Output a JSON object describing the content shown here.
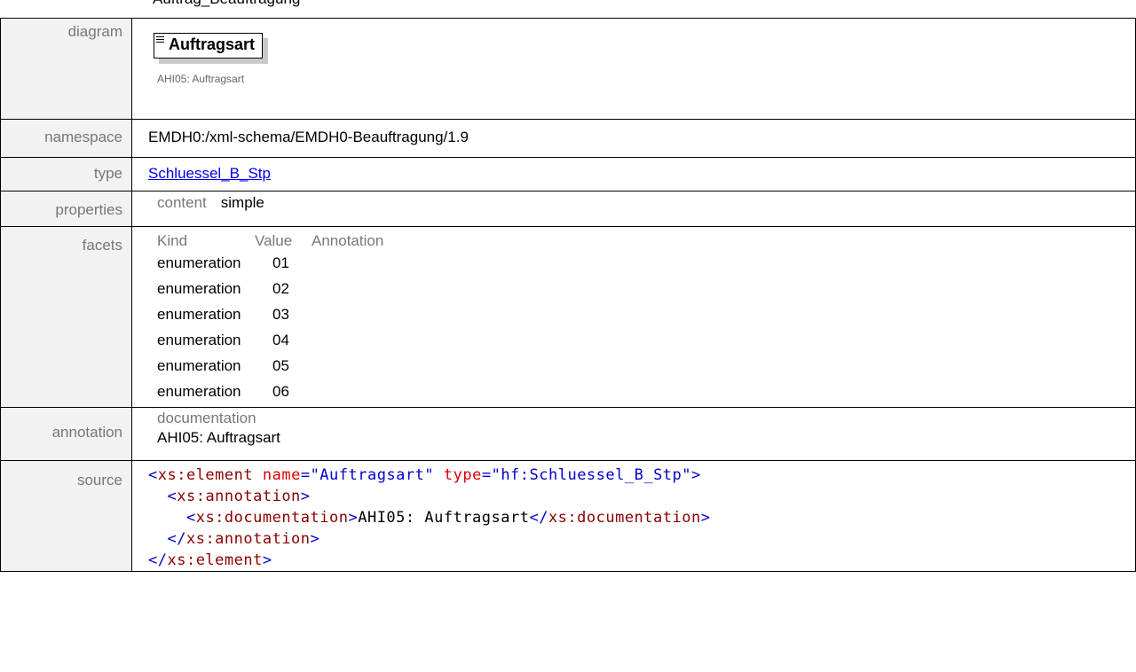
{
  "top_cut_text": "Auftrag_Beauftragung",
  "rows": {
    "diagram": {
      "label": "diagram",
      "element_name": "Auftragsart",
      "caption": "AHI05: Auftragsart"
    },
    "namespace": {
      "label": "namespace",
      "value": "EMDH0:/xml-schema/EMDH0-Beauftragung/1.9"
    },
    "type": {
      "label": "type",
      "value": "Schluessel_B_Stp"
    },
    "properties": {
      "label": "properties",
      "key": "content",
      "value": "simple"
    },
    "facets": {
      "label": "facets",
      "headers": [
        "Kind",
        "Value",
        "Annotation"
      ],
      "items": [
        {
          "kind": "enumeration",
          "value": "01"
        },
        {
          "kind": "enumeration",
          "value": "02"
        },
        {
          "kind": "enumeration",
          "value": "03"
        },
        {
          "kind": "enumeration",
          "value": "04"
        },
        {
          "kind": "enumeration",
          "value": "05"
        },
        {
          "kind": "enumeration",
          "value": "06"
        }
      ]
    },
    "annotation": {
      "label": "annotation",
      "header": "documentation",
      "text": "AHI05: Auftragsart"
    },
    "source": {
      "label": "source",
      "line1": {
        "open": "<",
        "tag": "xs:element",
        "attr1": "name",
        "eq1": "=",
        "val1": "\"Auftragsart\"",
        "attr2": "type",
        "eq2": "=",
        "val2": "\"hf:Schluessel_B_Stp\"",
        "close": ">"
      },
      "line2": {
        "indent": "  ",
        "open": "<",
        "tag": "xs:annotation",
        "close": ">"
      },
      "line3": {
        "indent": "    ",
        "open": "<",
        "tag": "xs:documentation",
        "close": ">",
        "text": "AHI05: Auftragsart",
        "open2": "</",
        "tag2": "xs:documentation",
        "close2": ">"
      },
      "line4": {
        "indent": "  ",
        "open": "</",
        "tag": "xs:annotation",
        "close": ">"
      },
      "line5": {
        "open": "</",
        "tag": "xs:element",
        "close": ">"
      }
    }
  },
  "colors": {
    "label_bg": "#f2f2f2",
    "label_text": "#777777",
    "link": "#0000ee",
    "xml_tag": "#8b0000",
    "xml_attr": "#e00000",
    "xml_value": "#0000cc"
  }
}
